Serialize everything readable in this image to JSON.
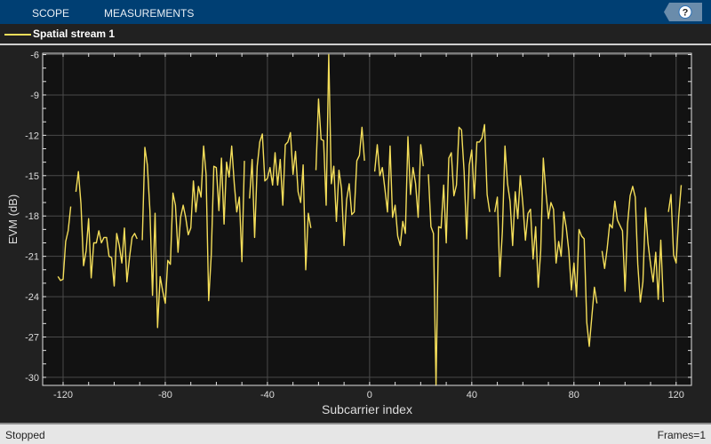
{
  "toolbar": {
    "tabs": [
      "SCOPE",
      "MEASUREMENTS"
    ],
    "help_label": "?"
  },
  "legend": {
    "label": "Spatial stream 1",
    "color": "#f4de5a"
  },
  "status": {
    "state": "Stopped",
    "frames": "Frames=1"
  },
  "chart_data": {
    "type": "line",
    "title": "",
    "xlabel": "Subcarrier index",
    "ylabel": "EVM (dB)",
    "xlim": [
      -128,
      126
    ],
    "ylim": [
      -30.6,
      -5.9
    ],
    "xticks": [
      -120,
      -80,
      -40,
      0,
      40,
      80,
      120
    ],
    "yticks": [
      -6,
      -9,
      -12,
      -15,
      -18,
      -21,
      -24,
      -27,
      -30
    ],
    "grid": true,
    "legend_position": "top-left",
    "series": [
      {
        "name": "Spatial stream 1",
        "color": "#f4de5a",
        "segments": [
          {
            "start": -122,
            "values": [
              -22.5,
              -22.8,
              -22.7,
              -19.9,
              -19.1,
              -17.3
            ]
          },
          {
            "start": -115,
            "values": [
              -16.2,
              -14.7,
              -17.1,
              -21.7,
              -20.6,
              -18.2,
              -22.6,
              -20.0,
              -20.0,
              -19.1,
              -20.0,
              -19.6,
              -19.6,
              -21.0,
              -21.1,
              -23.2,
              -19.3,
              -20.2,
              -21.5,
              -18.9,
              -22.9,
              -21.1,
              -19.6,
              -19.3,
              -19.7
            ]
          },
          {
            "start": -89,
            "values": [
              -19.8,
              -12.9,
              -14.2,
              -17.6,
              -23.9,
              -17.8,
              -26.3,
              -22.5,
              -23.6,
              -24.5,
              -21.3,
              -21.6,
              -16.3,
              -17.2,
              -20.7,
              -18.1,
              -17.2,
              -18.1,
              -19.4,
              -18.9,
              -15.4,
              -17.7,
              -15.8,
              -16.6,
              -12.8,
              -14.9,
              -24.3,
              -20.9,
              -14.3,
              -14.4,
              -17.6,
              -13.7,
              -18.6,
              -14.0,
              -15.1,
              -12.8,
              -15.6,
              -17.7,
              -16.6,
              -21.4,
              -13.9
            ]
          },
          {
            "start": -47,
            "values": [
              -16.7,
              -13.8,
              -19.6,
              -14.3,
              -12.5,
              -11.9,
              -15.4,
              -15.2,
              -14.4,
              -15.7,
              -13.3,
              -15.7,
              -13.8,
              -17.2,
              -12.7,
              -12.5,
              -11.8,
              -14.9,
              -13.2,
              -16.2,
              -17.0,
              -14.2,
              -22.0,
              -17.8,
              -18.9
            ]
          },
          {
            "start": -21,
            "values": [
              -14.6,
              -9.3,
              -12.3,
              -12.4,
              -17.2,
              -6.0,
              -15.6,
              -14.3,
              -18.4,
              -14.6,
              -16.0,
              -20.2,
              -16.8,
              -15.6,
              -17.9,
              -17.7,
              -13.9,
              -13.5,
              -11.4,
              -13.9
            ]
          },
          {
            "start": 2,
            "values": [
              -14.7,
              -12.7,
              -15.0,
              -14.4,
              -16.0,
              -17.7,
              -12.8,
              -18.1,
              -17.2,
              -19.5,
              -20.2,
              -18.4,
              -19.3,
              -12.1,
              -16.4,
              -14.4,
              -15.6,
              -18.1,
              -12.7,
              -14.3
            ]
          },
          {
            "start": 23,
            "values": [
              -14.9,
              -18.8,
              -19.3,
              -30.6,
              -18.8,
              -18.9,
              -15.7,
              -20.0,
              -13.7,
              -13.3,
              -16.5,
              -15.7,
              -11.4,
              -11.6,
              -14.7,
              -19.7,
              -14.2,
              -13.1,
              -16.7,
              -12.5,
              -12.5,
              -12.2,
              -11.2,
              -16.4,
              -17.7
            ]
          },
          {
            "start": 49,
            "values": [
              -17.7,
              -16.6,
              -22.5,
              -19.1,
              -12.8,
              -15.6,
              -16.9,
              -20.2,
              -16.2,
              -18.2,
              -15.0,
              -17.1,
              -19.8,
              -17.8,
              -17.5,
              -21.2,
              -18.8,
              -23.3,
              -20.6,
              -13.7,
              -16.2,
              -18.2,
              -17.0,
              -17.5,
              -21.5,
              -19.9,
              -21.0,
              -17.7,
              -18.9,
              -20.6,
              -23.5,
              -21.5,
              -24.0,
              -19.0,
              -19.5,
              -19.7,
              -25.9,
              -27.7,
              -25.5,
              -23.3,
              -24.5
            ]
          },
          {
            "start": 91,
            "values": [
              -20.6,
              -21.9,
              -20.4,
              -18.6,
              -18.9,
              -16.9,
              -18.3,
              -18.7,
              -19.1,
              -23.6,
              -18.6,
              -16.5,
              -15.8,
              -16.6,
              -21.6,
              -24.4,
              -22.9,
              -17.4,
              -20.0,
              -21.6,
              -22.9,
              -20.7,
              -24.2,
              -19.8,
              -24.4
            ]
          },
          {
            "start": 117,
            "values": [
              -17.7,
              -16.4,
              -20.9,
              -21.5,
              -18.1,
              -15.7
            ]
          }
        ]
      }
    ]
  }
}
